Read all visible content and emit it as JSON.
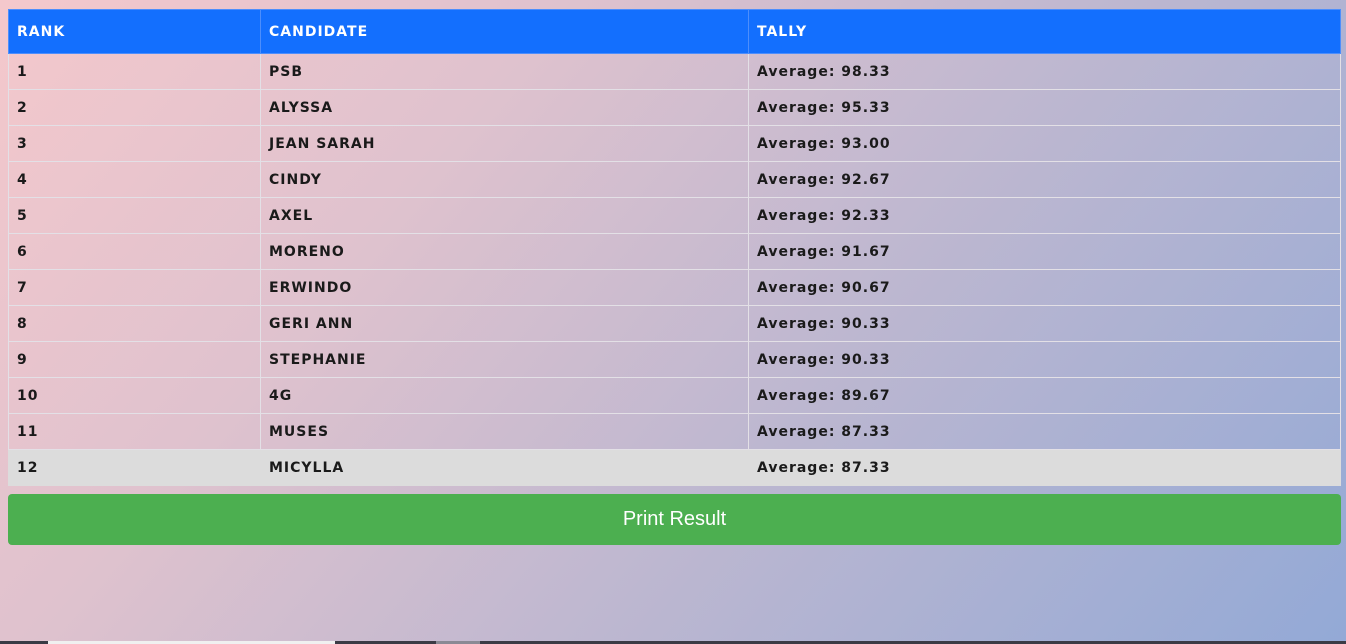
{
  "table": {
    "headers": {
      "rank": "RANK",
      "candidate": "CANDIDATE",
      "tally": "TALLY"
    },
    "rows": [
      {
        "rank": "1",
        "candidate": "PSB",
        "tally": "Average: 98.33"
      },
      {
        "rank": "2",
        "candidate": "ALYSSA",
        "tally": "Average: 95.33"
      },
      {
        "rank": "3",
        "candidate": "JEAN SARAH",
        "tally": "Average: 93.00"
      },
      {
        "rank": "4",
        "candidate": "CINDY",
        "tally": "Average: 92.67"
      },
      {
        "rank": "5",
        "candidate": "AXEL",
        "tally": "Average: 92.33"
      },
      {
        "rank": "6",
        "candidate": "MORENO",
        "tally": "Average: 91.67"
      },
      {
        "rank": "7",
        "candidate": "ERWINDO",
        "tally": "Average: 90.67"
      },
      {
        "rank": "8",
        "candidate": "GERI ANN",
        "tally": "Average: 90.33"
      },
      {
        "rank": "9",
        "candidate": "STEPHANIE",
        "tally": "Average: 90.33"
      },
      {
        "rank": "10",
        "candidate": "4G",
        "tally": "Average: 89.67"
      },
      {
        "rank": "11",
        "candidate": "MUSES",
        "tally": "Average: 87.33"
      },
      {
        "rank": "12",
        "candidate": "MICYLLA",
        "tally": "Average: 87.33"
      }
    ],
    "highlighted_row": "12"
  },
  "actions": {
    "print_label": "Print Result"
  },
  "colors": {
    "header_bg": "#136ffe",
    "button_bg": "#4caf50",
    "highlight_row_bg": "#dcdcdc"
  }
}
